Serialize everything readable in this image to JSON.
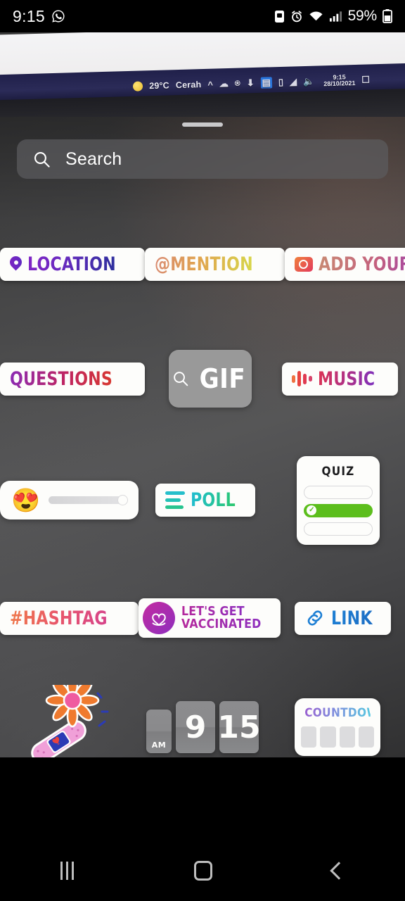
{
  "status_bar": {
    "time": "9:15",
    "app_icon": "whatsapp-icon",
    "battery_percent": "59%",
    "icons": [
      "sim-icon",
      "alarm-icon",
      "wifi-icon",
      "cellular-signal-icon",
      "battery-icon"
    ]
  },
  "background_photo": {
    "taskbar": {
      "weather_temp": "29°C",
      "weather_label": "Cerah",
      "time": "9:15",
      "date": "28/10/2021"
    }
  },
  "sheet": {
    "search": {
      "placeholder": "Search",
      "icon": "search-icon"
    }
  },
  "stickers": {
    "row1": [
      {
        "name": "location",
        "label": "LOCATION",
        "icon": "map-pin-icon"
      },
      {
        "name": "mention",
        "label": "@MENTION",
        "icon": "none"
      },
      {
        "name": "add-yours",
        "label": "ADD YOURS",
        "icon": "camera-icon"
      }
    ],
    "row2": [
      {
        "name": "questions",
        "label": "QUESTIONS",
        "icon": "none"
      },
      {
        "name": "gif",
        "label": "GIF",
        "icon": "search-icon"
      },
      {
        "name": "music",
        "label": "MUSIC",
        "icon": "audio-bars-icon"
      }
    ],
    "row3": [
      {
        "name": "emoji-slider",
        "label": "",
        "emoji": "😍",
        "icon": "slider-icon"
      },
      {
        "name": "poll",
        "label": "POLL",
        "icon": "poll-bars-icon"
      },
      {
        "name": "quiz",
        "label": "QUIZ",
        "options": [
          "",
          "",
          ""
        ],
        "correct_index": 1
      }
    ],
    "row4": [
      {
        "name": "hashtag",
        "label": "#HASHTAG",
        "icon": "none"
      },
      {
        "name": "lets-get-vaccinated",
        "label_line1": "LET'S GET",
        "label_line2": "VACCINATED",
        "icon": "heart-badge-icon"
      },
      {
        "name": "link",
        "label": "LINK",
        "icon": "chain-link-icon"
      }
    ],
    "row5": [
      {
        "name": "vaccine-flower-sticker",
        "label": "",
        "icon": "bandage-flower-icon"
      },
      {
        "name": "clock",
        "ampm": "AM",
        "hour": "9",
        "minute": "15"
      },
      {
        "name": "countdown",
        "label": "COUNTDOWN",
        "tiles": 4
      }
    ]
  },
  "nav_bar": {
    "recents_label": "recents-button",
    "home_label": "home-button",
    "back_label": "back-button"
  },
  "colors": {
    "sheet_bg": "#4a4a4b",
    "chip_bg": "#fdfdfb",
    "quiz_green": "#5cbe1c",
    "gif_gray": "#a0a0a0",
    "link_blue": "#1d7fd4"
  }
}
